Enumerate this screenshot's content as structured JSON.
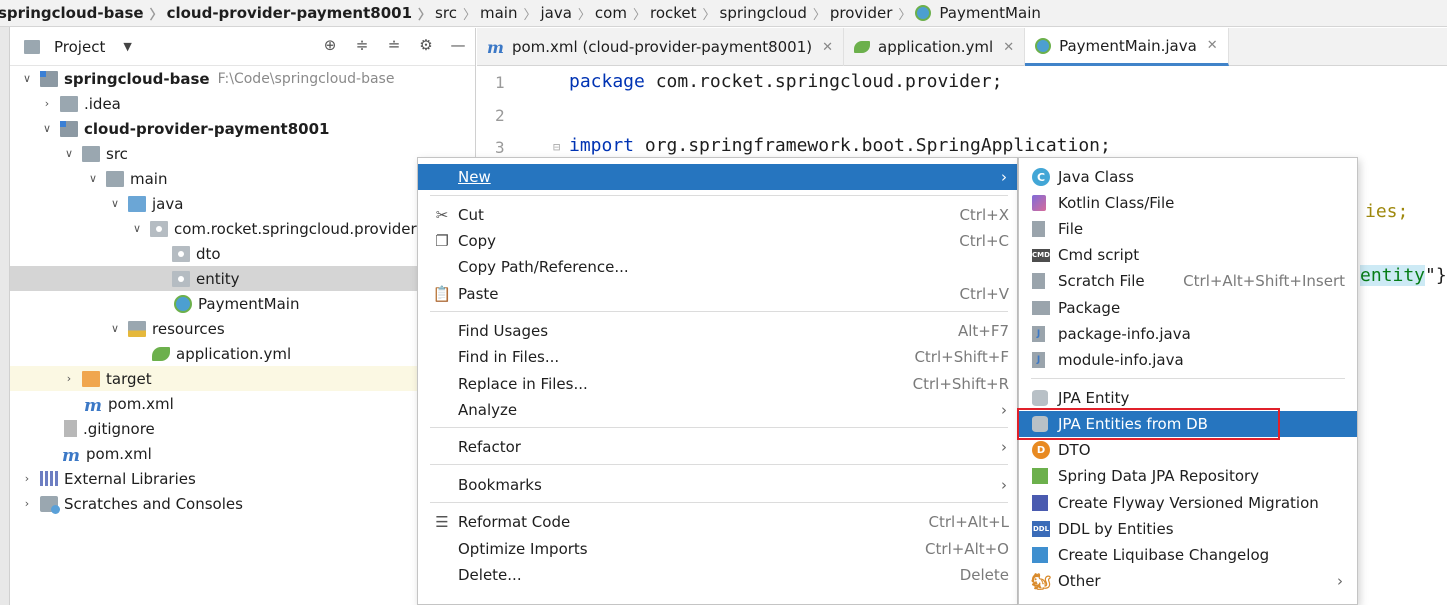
{
  "breadcrumb": [
    {
      "label": "springcloud-base",
      "bold": true
    },
    {
      "label": "cloud-provider-payment8001",
      "bold": true
    },
    {
      "label": "src"
    },
    {
      "label": "main"
    },
    {
      "label": "java"
    },
    {
      "label": "com"
    },
    {
      "label": "rocket"
    },
    {
      "label": "springcloud"
    },
    {
      "label": "provider"
    },
    {
      "label": "PaymentMain",
      "icon": "spring-class-icon"
    }
  ],
  "project_panel": {
    "title": "Project",
    "tree": [
      {
        "label": "springcloud-base",
        "hint": "F:\\Code\\springcloud-base",
        "bold": true
      },
      {
        "label": ".idea"
      },
      {
        "label": "cloud-provider-payment8001",
        "bold": true
      },
      {
        "label": "src"
      },
      {
        "label": "main"
      },
      {
        "label": "java"
      },
      {
        "label": "com.rocket.springcloud.provider"
      },
      {
        "label": "dto"
      },
      {
        "label": "entity"
      },
      {
        "label": "PaymentMain"
      },
      {
        "label": "resources"
      },
      {
        "label": "application.yml"
      },
      {
        "label": "target"
      },
      {
        "label": "pom.xml"
      },
      {
        "label": ".gitignore"
      },
      {
        "label": "pom.xml"
      },
      {
        "label": "External Libraries"
      },
      {
        "label": "Scratches and Consoles"
      }
    ]
  },
  "editor_tabs": [
    {
      "label": "pom.xml (cloud-provider-payment8001)",
      "icon": "maven-icon"
    },
    {
      "label": "application.yml",
      "icon": "yaml-leaf-icon"
    },
    {
      "label": "PaymentMain.java",
      "icon": "spring-class-icon",
      "active": true
    }
  ],
  "editor": {
    "line_numbers": [
      "1",
      "2",
      "3"
    ],
    "line1_kw": "package",
    "line1_rest": " com.rocket.springcloud.provider;",
    "line3_kw": "import",
    "line3_rest": " org.springframework.boot.SpringApplication;",
    "peek1": "ies;",
    "peek2_hl": "entity",
    "peek2_tail": "\"}"
  },
  "context_menu": {
    "items": [
      {
        "label": "New",
        "mnemonic": "N",
        "submenu": true,
        "active": true
      },
      {
        "label": "Cut",
        "shortcut": "Ctrl+X",
        "icon": "scissors-icon"
      },
      {
        "label": "Copy",
        "shortcut": "Ctrl+C",
        "icon": "copy-icon"
      },
      {
        "label": "Copy Path/Reference..."
      },
      {
        "label": "Paste",
        "shortcut": "Ctrl+V",
        "icon": "paste-icon"
      },
      {
        "label": "Find Usages",
        "shortcut": "Alt+F7"
      },
      {
        "label": "Find in Files...",
        "shortcut": "Ctrl+Shift+F"
      },
      {
        "label": "Replace in Files...",
        "shortcut": "Ctrl+Shift+R"
      },
      {
        "label": "Analyze",
        "submenu": true
      },
      {
        "label": "Refactor",
        "submenu": true
      },
      {
        "label": "Bookmarks",
        "submenu": true
      },
      {
        "label": "Reformat Code",
        "shortcut": "Ctrl+Alt+L",
        "icon": "reformat-icon"
      },
      {
        "label": "Optimize Imports",
        "shortcut": "Ctrl+Alt+O"
      },
      {
        "label": "Delete...",
        "shortcut": "Delete"
      }
    ]
  },
  "submenu": {
    "items": [
      {
        "label": "Java Class",
        "icon": "java-class-icon",
        "glyph": "C"
      },
      {
        "label": "Kotlin Class/File",
        "icon": "kotlin-icon"
      },
      {
        "label": "File",
        "icon": "file-icon"
      },
      {
        "label": "Cmd script",
        "icon": "cmd-icon",
        "glyph": "CMD"
      },
      {
        "label": "Scratch File",
        "shortcut": "Ctrl+Alt+Shift+Insert",
        "icon": "scratch-file-icon"
      },
      {
        "label": "Package",
        "icon": "package-icon"
      },
      {
        "label": "package-info.java",
        "icon": "java-file-icon",
        "glyph": "J"
      },
      {
        "label": "module-info.java",
        "icon": "java-file-icon",
        "glyph": "J"
      },
      {
        "label": "JPA Entity",
        "icon": "database-icon"
      },
      {
        "label": "JPA Entities from DB",
        "icon": "database-icon",
        "active": true
      },
      {
        "label": "DTO",
        "icon": "dto-icon",
        "glyph": "D"
      },
      {
        "label": "Spring Data JPA Repository",
        "icon": "repository-icon"
      },
      {
        "label": "Create Flyway Versioned Migration",
        "icon": "flyway-icon"
      },
      {
        "label": "DDL by Entities",
        "icon": "ddl-icon",
        "glyph": "DDL"
      },
      {
        "label": "Create Liquibase Changelog",
        "icon": "liquibase-icon"
      },
      {
        "label": "Other",
        "icon": "other-icon",
        "glyph": "🐿",
        "submenu": true
      }
    ]
  },
  "colors": {
    "menu_highlight": "#2675bf",
    "annotation_box": "#e0202a",
    "selected_row": "#d5d5d5"
  }
}
